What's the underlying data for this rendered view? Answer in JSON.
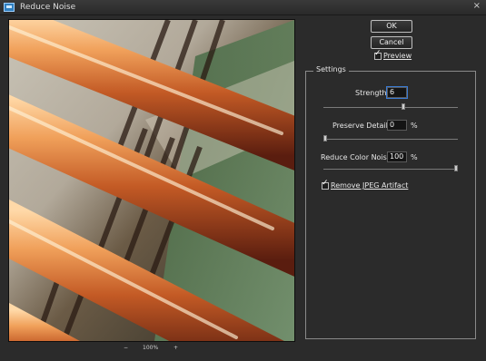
{
  "window": {
    "title": "Reduce Noise",
    "close_glyph": "×"
  },
  "preview": {
    "zoom_label": "100%",
    "zoom_minus": "−",
    "zoom_plus": "+"
  },
  "buttons": {
    "ok": "OK",
    "cancel": "Cancel"
  },
  "preview_toggle": {
    "label": "Preview",
    "checked": true
  },
  "settings": {
    "title": "Settings",
    "strength": {
      "label": "Strength:",
      "value": "6",
      "slider_fraction": 0.6
    },
    "preserve_details": {
      "label": "Preserve Details:",
      "value": "0",
      "unit": "%",
      "slider_fraction": 0.0
    },
    "reduce_color_noise": {
      "label": "Reduce Color Noise:",
      "value": "100",
      "unit": "%",
      "slider_fraction": 1.0
    },
    "remove_jpeg_artifact": {
      "label": "Remove JPEG Artifact",
      "checked": true
    }
  },
  "colors": {
    "background": "#2b2b2b",
    "accent_focus": "#3a7bd5"
  }
}
